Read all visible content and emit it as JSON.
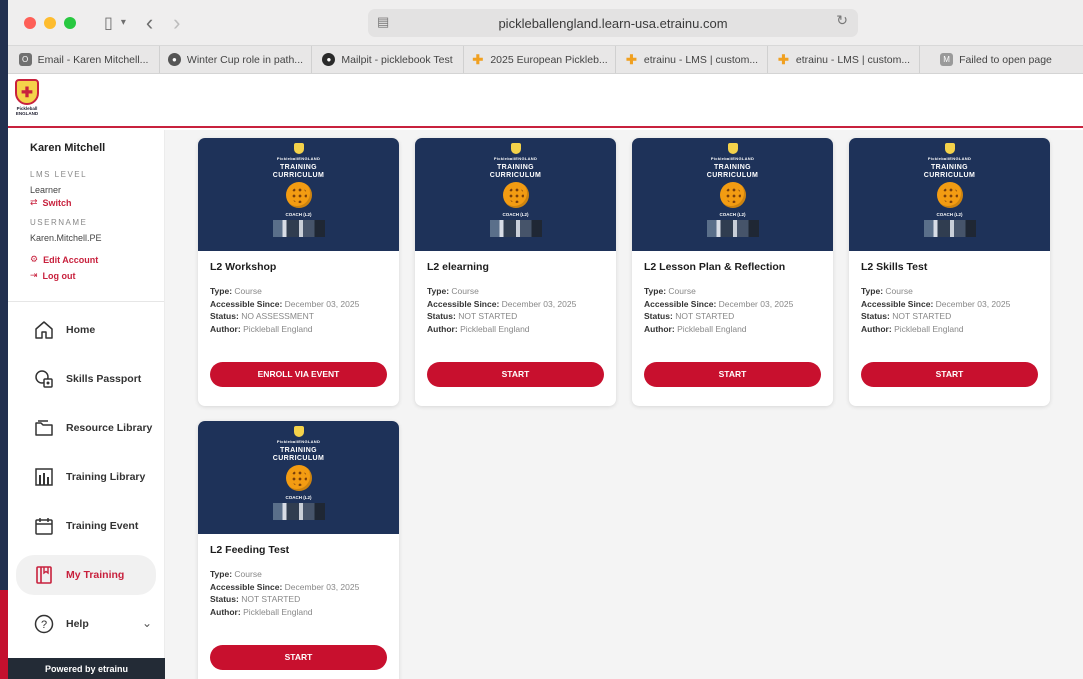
{
  "browser": {
    "url": "pickleballengland.learn-usa.etrainu.com",
    "bookmarks": [
      {
        "icon": "mail-icon",
        "label": "Email - Karen Mitchell..."
      },
      {
        "icon": "globe-icon",
        "label": "Winter Cup role in path..."
      },
      {
        "icon": "mailpit-icon",
        "label": "Mailpit - picklebook Test"
      },
      {
        "icon": "cross-icon",
        "label": "2025 European Pickleb..."
      },
      {
        "icon": "cross-icon",
        "label": "etrainu - LMS | custom..."
      },
      {
        "icon": "cross-icon",
        "label": "etrainu - LMS | custom..."
      },
      {
        "icon": "m-icon",
        "label": "Failed to open page"
      }
    ]
  },
  "header": {
    "logo_text": "Pickleball ENGLAND"
  },
  "profile": {
    "name": "Karen Mitchell",
    "lms_level_caption": "LMS LEVEL",
    "lms_level": "Learner",
    "switch_label": "Switch",
    "username_caption": "USERNAME",
    "username": "Karen.Mitchell.PE",
    "edit_account_label": "Edit Account",
    "logout_label": "Log out"
  },
  "nav": {
    "items": [
      {
        "label": "Home",
        "icon": "home-icon"
      },
      {
        "label": "Skills Passport",
        "icon": "skills-passport-icon"
      },
      {
        "label": "Resource Library",
        "icon": "folder-icon"
      },
      {
        "label": "Training Library",
        "icon": "library-icon"
      },
      {
        "label": "Training Event",
        "icon": "calendar-icon"
      },
      {
        "label": "My Training",
        "icon": "book-icon",
        "active": true
      },
      {
        "label": "Help",
        "icon": "help-icon"
      }
    ],
    "powered_by": "Powered by etrainu"
  },
  "labels": {
    "type": "Type:",
    "accessible_since": "Accessible Since:",
    "status": "Status:",
    "author": "Author:"
  },
  "thumbnail": {
    "org": "PickleballENGLAND",
    "title_line1": "TRAINING",
    "title_line2": "CURRICULUM",
    "coach": "COACH (L2)"
  },
  "courses": [
    {
      "title": "L2 Workshop",
      "type": "Course",
      "accessible_since": "December 03, 2025",
      "status": "NO ASSESSMENT",
      "author": "Pickleball England",
      "button": "ENROLL VIA EVENT"
    },
    {
      "title": "L2 elearning",
      "type": "Course",
      "accessible_since": "December 03, 2025",
      "status": "NOT STARTED",
      "author": "Pickleball England",
      "button": "START"
    },
    {
      "title": "L2 Lesson Plan & Reflection",
      "type": "Course",
      "accessible_since": "December 03, 2025",
      "status": "NOT STARTED",
      "author": "Pickleball England",
      "button": "START"
    },
    {
      "title": "L2 Skills Test",
      "type": "Course",
      "accessible_since": "December 03, 2025",
      "status": "NOT STARTED",
      "author": "Pickleball England",
      "button": "START"
    },
    {
      "title": "L2 Feeding Test",
      "type": "Course",
      "accessible_since": "December 03, 2025",
      "status": "NOT STARTED",
      "author": "Pickleball England",
      "button": "START"
    }
  ],
  "colors": {
    "brand_red": "#c8102e",
    "navy": "#1e3259"
  }
}
